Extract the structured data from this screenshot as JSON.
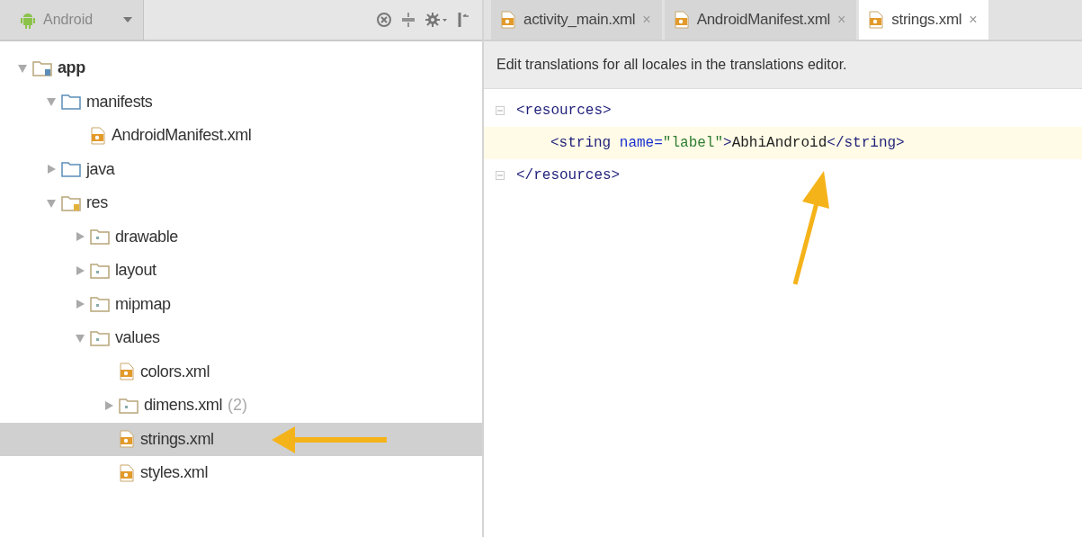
{
  "project_view": {
    "label": "Android"
  },
  "tree": [
    {
      "label": "app",
      "kind": "module",
      "expanded": true,
      "selected": false,
      "children": [
        {
          "label": "manifests",
          "kind": "folder",
          "expanded": true,
          "selected": false,
          "children": [
            {
              "label": "AndroidManifest.xml",
              "kind": "file",
              "selected": false
            }
          ]
        },
        {
          "label": "java",
          "kind": "folder",
          "expanded": false,
          "selected": false
        },
        {
          "label": "res",
          "kind": "res-folder",
          "expanded": true,
          "selected": false,
          "children": [
            {
              "label": "drawable",
              "kind": "res-dir",
              "expanded": false,
              "selected": false
            },
            {
              "label": "layout",
              "kind": "res-dir",
              "expanded": false,
              "selected": false
            },
            {
              "label": "mipmap",
              "kind": "res-dir",
              "expanded": false,
              "selected": false
            },
            {
              "label": "values",
              "kind": "res-dir",
              "expanded": true,
              "selected": false,
              "children": [
                {
                  "label": "colors.xml",
                  "kind": "file",
                  "selected": false
                },
                {
                  "label": "dimens.xml",
                  "count": "(2)",
                  "kind": "res-dir",
                  "expanded": false,
                  "selected": false
                },
                {
                  "label": "strings.xml",
                  "kind": "file",
                  "selected": true
                },
                {
                  "label": "styles.xml",
                  "kind": "file",
                  "selected": false
                }
              ]
            }
          ]
        }
      ]
    }
  ],
  "tabs": [
    {
      "label": "activity_main.xml",
      "close": "×",
      "selected": false
    },
    {
      "label": "AndroidManifest.xml",
      "close": "×",
      "selected": false
    },
    {
      "label": "strings.xml",
      "close": "×",
      "selected": true
    }
  ],
  "banner": "Edit translations for all locales in the translations editor.",
  "code": [
    {
      "current": false,
      "kind": "open",
      "tokens": [
        {
          "kind": "tag",
          "text": "<resources>"
        }
      ]
    },
    {
      "current": true,
      "kind": "element",
      "tokens": [
        {
          "kind": "tag",
          "text": "<string "
        },
        {
          "kind": "attr",
          "text": "name="
        },
        {
          "kind": "value",
          "text": "\"label\""
        },
        {
          "kind": "tag",
          "text": ">"
        },
        {
          "kind": "text",
          "text": "AbhiAndroid"
        },
        {
          "kind": "tag",
          "text": "</string>"
        }
      ]
    },
    {
      "current": false,
      "kind": "close",
      "tokens": [
        {
          "kind": "tag",
          "text": "</resources>"
        }
      ]
    }
  ]
}
